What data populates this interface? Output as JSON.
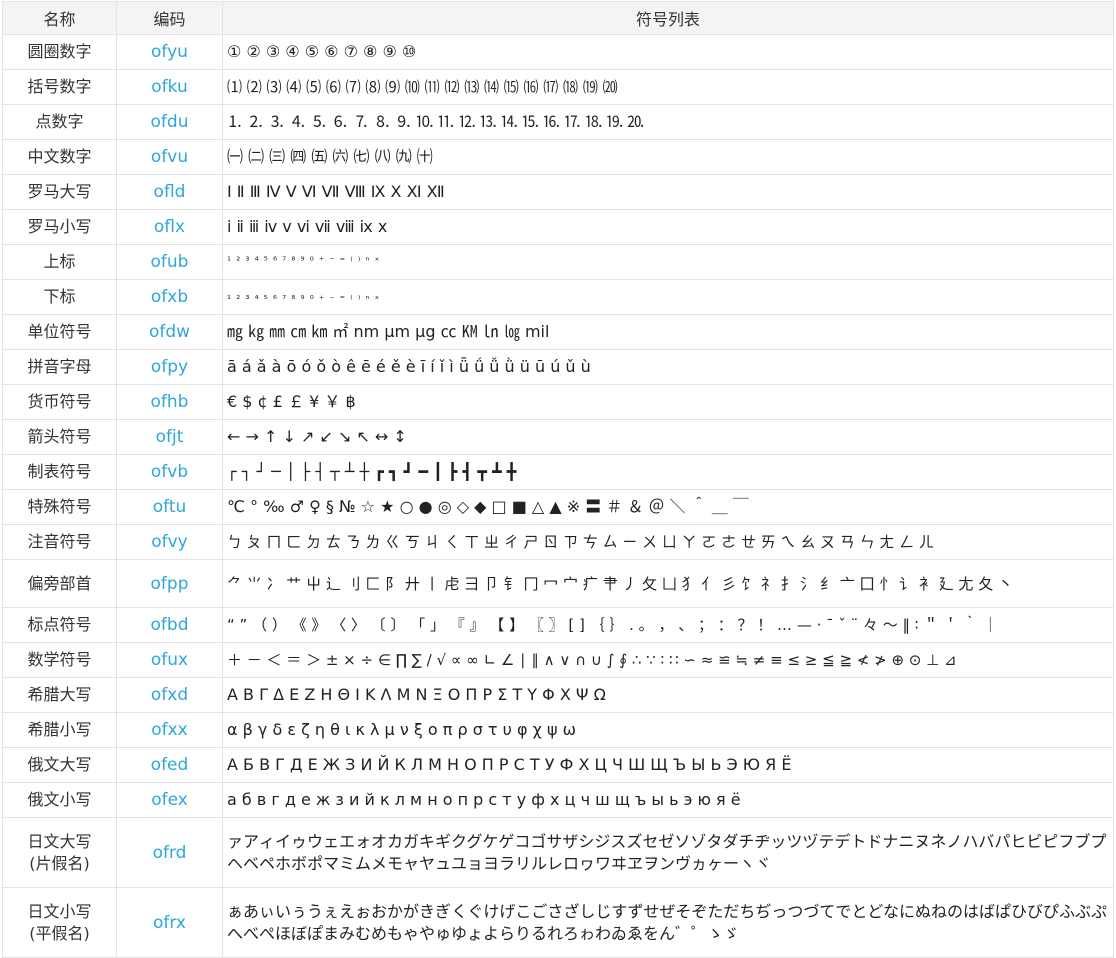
{
  "header": {
    "name": "名称",
    "code": "编码",
    "symbols": "符号列表"
  },
  "rows": [
    {
      "name": "圆圈数字",
      "code": "ofyu",
      "symbols": "① ② ③ ④ ⑤ ⑥ ⑦ ⑧ ⑨ ⑩"
    },
    {
      "name": "括号数字",
      "code": "ofku",
      "symbols": "⑴ ⑵ ⑶ ⑷ ⑸ ⑹ ⑺ ⑻ ⑼ ⑽ ⑾ ⑿ ⒀ ⒁ ⒂ ⒃ ⒄ ⒅ ⒆ ⒇"
    },
    {
      "name": "点数字",
      "code": "ofdu",
      "symbols": "⒈ ⒉ ⒊ ⒋ ⒌ ⒍ ⒎ ⒏ ⒐ ⒑ ⒒ ⒓ ⒔ ⒕ ⒖ ⒗ ⒘ ⒙ ⒚ ⒛"
    },
    {
      "name": "中文数字",
      "code": "ofvu",
      "symbols": "㈠ ㈡ ㈢ ㈣ ㈤ ㈥ ㈦ ㈧ ㈨ ㈩"
    },
    {
      "name": "罗马大写",
      "code": "ofld",
      "symbols": "Ⅰ Ⅱ Ⅲ Ⅳ Ⅴ Ⅵ Ⅶ Ⅷ Ⅸ Ⅹ Ⅺ Ⅻ"
    },
    {
      "name": "罗马小写",
      "code": "oflx",
      "symbols": "ⅰ ⅱ ⅲ ⅳ ⅴ ⅵ ⅶ ⅷ ⅸ ⅹ"
    },
    {
      "name": "上标",
      "code": "ofub",
      "symbols": "¹ ² ³ ⁴ ⁵ ⁶ ⁷ ⁸ ⁹ ⁰ ⁺ ⁻ ⁼ ⁽ ⁾ ⁿ ˣ"
    },
    {
      "name": "下标",
      "code": "ofxb",
      "symbols": "₁ ₂ ₃ ₄ ₅ ₆ ₇ ₈ ₉ ₀ ₊ ₋ ₌ ₍ ₎ ₙ ₓ"
    },
    {
      "name": "单位符号",
      "code": "ofdw",
      "symbols": "㎎ ㎏ ㎜ ㎝ ㎞ ㎡ nm μm μg ㏄ ㏎ ㏑ ㏒ mil"
    },
    {
      "name": "拼音字母",
      "code": "ofpy",
      "symbols": "ā á ǎ à ō ó ǒ ò ê ē é ě è ī í ǐ ì ǖ ǘ ǚ ǜ ü ū ú ǔ ù"
    },
    {
      "name": "货币符号",
      "code": "ofhb",
      "symbols": "€ $ ¢ £ ￡ ¥ ￥ ฿"
    },
    {
      "name": "箭头符号",
      "code": "ofjt",
      "symbols": "← → ↑ ↓ ↗ ↙ ↘ ↖ ↔ ↕"
    },
    {
      "name": "制表符号",
      "code": "ofvb",
      "symbols": "┌ ┐ ┘ ─ │ ├ ┤ ┬ ┴ ┼ ┏ ┓ ┛ ━ ┃ ┣ ┫ ┳ ┻ ╋"
    },
    {
      "name": "特殊符号",
      "code": "oftu",
      "symbols": "℃ ° ‰ ♂ ♀ § № ☆ ★ ○ ● ◎ ◇ ◆ □ ■ △ ▲ ※ 〓 ＃ ＆ ＠ ＼ ＾ ＿ ￣"
    },
    {
      "name": "注音符号",
      "code": "ofvy",
      "symbols": "ㄅ ㄆ ㄇ ㄈ ㄉ ㄊ ㄋ ㄌ ㄍ ㄎ ㄐ ㄑ ㄒ ㄓ ㄔ ㄕ ㄖ ㄗ ㄘ ㄙ ㄧ ㄨ ㄩ ㄚ ㄛ ㄜ ㄝ ㄞ ㄟ ㄠ ㄡ ㄢ ㄣ ㄤ ㄥ ㄦ"
    },
    {
      "name": "偏旁部首",
      "code": "ofpp",
      "symbols": "⺈ ⺌ 冫 艹 屮 辶 刂 匚 阝 廾 丨 虍 彐 卩 钅 冂 冖 宀 疒 肀 丿 攵 凵 犭 亻 彡 饣 礻 扌 氵 纟 亠 囗 忄 讠 衤 廴 尢 夂 丶"
    },
    {
      "name": "标点符号",
      "code": "ofbd",
      "symbols": "“ ” （ ） 《 》 〈 〉 〔 〕 「 」 『 』 【 】 〖 〗 [ ] ｛ ｝ . 。 ， 、 ； ： ？ ！ … — · ˉ ˇ ¨ 々 ～ ‖ ∶ ＂ ＇ ｀ ｜"
    },
    {
      "name": "数学符号",
      "code": "ofux",
      "symbols": "＋ － ＜ ＝ ＞ ± × ÷ ∈ ∏ ∑ ∕ √ ∝ ∞ ∟ ∠ ∣ ∥ ∧ ∨ ∩ ∪ ∫ ∮ ∴ ∵ ∶ ∷ ∽ ≈ ≌ ≒ ≠ ≡ ≤ ≥ ≦ ≧ ≮ ≯ ⊕ ⊙ ⊥ ⊿"
    },
    {
      "name": "希腊大写",
      "code": "ofxd",
      "symbols": "Α Β Γ Δ Ε Ζ Η Θ Ι Κ Λ Μ Ν Ξ Ο Π Ρ Σ Τ Υ Φ Χ Ψ Ω"
    },
    {
      "name": "希腊小写",
      "code": "ofxx",
      "symbols": "α β γ δ ε ζ η θ ι κ λ μ ν ξ ο π ρ σ τ υ φ χ ψ ω"
    },
    {
      "name": "俄文大写",
      "code": "ofed",
      "symbols": "А Б В Г Д Е Ж З И Й К Л М Н О П Р С Т У Ф Х Ц Ч Ш Щ Ъ Ы Ь Э Ю Я Ё"
    },
    {
      "name": "俄文小写",
      "code": "ofex",
      "symbols": "а б в г д е ж з и й к л м н о п р с т у ф х ц ч ш щ ъ ы ь э ю я ё"
    },
    {
      "name": "日文大写",
      "name2": "(片假名)",
      "code": "ofrd",
      "symbols": "ァアィイゥウェエォオカガキギクグケゲコゴサザシジスズセゼソゾタダチヂッツヅテデトドナニヌネノハバパヒビピフブプヘベペホボポマミムメモャヤュユョヨラリルレロヮワヰヱヲンヴヵヶーヽヾ"
    },
    {
      "name": "日文小写",
      "name2": "(平假名)",
      "code": "ofrx",
      "symbols": "ぁあぃいぅうぇえぉおかがきぎくぐけげこごさざしじすずせぜそぞただちぢっつづてでとどなにぬねのはばぱひびぴふぶぷへべぺほぼぽまみむめもゃやゅゆょよらりるれろゎわゐゑをん゛゜ゝゞ"
    }
  ]
}
